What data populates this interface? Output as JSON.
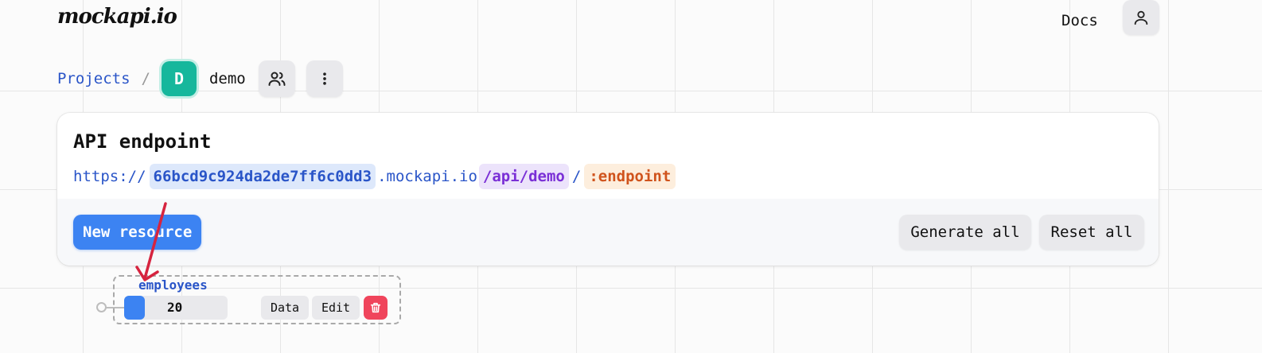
{
  "header": {
    "logo": "mockapi.io",
    "docs_label": "Docs",
    "user_icon": "user-icon"
  },
  "breadcrumb": {
    "projects_label": "Projects",
    "separator": "/",
    "project_initial": "D",
    "project_name": "demo",
    "members_icon": "users-icon",
    "menu_icon": "more-vertical-icon"
  },
  "endpoint_card": {
    "title": "API endpoint",
    "url": {
      "scheme": "https://",
      "host": "66bcd9c924da2de7ff6c0dd3",
      "domain": ".mockapi.io",
      "path": "/api/demo",
      "slash": "/",
      "endpoint": ":endpoint"
    },
    "new_resource_label": "New resource",
    "generate_all_label": "Generate all",
    "reset_all_label": "Reset all"
  },
  "resources": [
    {
      "name": "employees",
      "count": "20",
      "data_label": "Data",
      "edit_label": "Edit",
      "delete_icon": "trash-icon"
    }
  ],
  "colors": {
    "accent": "#3c83f2",
    "avatar": "#16b79c",
    "link": "#2a55c8",
    "path": "#7a2fd6",
    "endpoint": "#d0531c",
    "danger": "#f0455c",
    "annotation_arrow": "#d6243f"
  }
}
